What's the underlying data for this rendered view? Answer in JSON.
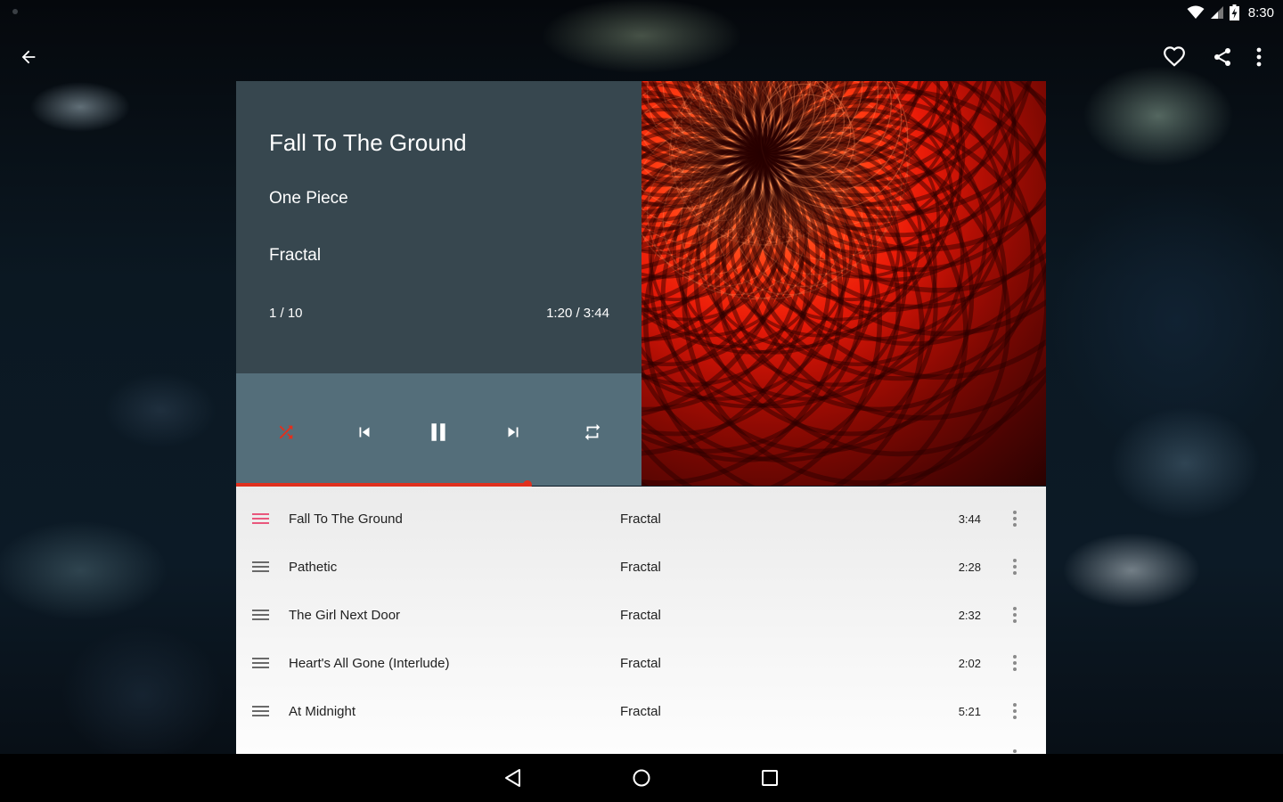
{
  "status_bar": {
    "time": "8:30",
    "icons": [
      "notification-dot",
      "wifi-icon",
      "signal-icon",
      "battery-charging-icon"
    ]
  },
  "app_bar": {
    "back_icon": "arrow-back-icon",
    "actions": [
      "favorite-icon",
      "share-icon",
      "more-vert-icon"
    ]
  },
  "now_playing": {
    "title": "Fall To The Ground",
    "artist": "One Piece",
    "album": "Fractal",
    "position": "1 / 10",
    "time": "1:20 / 3:44",
    "progress_fraction": 0.36,
    "shuffle_active": true
  },
  "controls": {
    "icons": [
      "shuffle-icon",
      "skip-previous-icon",
      "pause-icon",
      "skip-next-icon",
      "repeat-icon"
    ]
  },
  "colors": {
    "accent": "#e0301e",
    "drag_active": "#e9577c",
    "info_panel": "#37474f",
    "controls_panel": "#546e7a"
  },
  "queue": [
    {
      "title": "Fall To The Ground",
      "album": "Fractal",
      "duration": "3:44",
      "active": true
    },
    {
      "title": "Pathetic",
      "album": "Fractal",
      "duration": "2:28",
      "active": false
    },
    {
      "title": "The Girl Next Door",
      "album": "Fractal",
      "duration": "2:32",
      "active": false
    },
    {
      "title": "Heart's All Gone (Interlude)",
      "album": "Fractal",
      "duration": "2:02",
      "active": false
    },
    {
      "title": "At Midnight",
      "album": "Fractal",
      "duration": "5:21",
      "active": false
    }
  ],
  "nav_bar": {
    "icons": [
      "nav-back-icon",
      "nav-home-icon",
      "nav-recents-icon"
    ]
  }
}
